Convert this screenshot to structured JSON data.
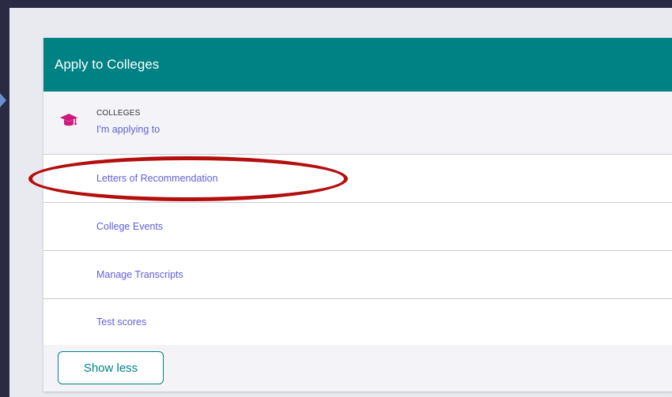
{
  "card": {
    "title": "Apply to Colleges",
    "colleges": {
      "label": "COLLEGES",
      "link": "I'm applying to",
      "icon": "graduation-cap-icon"
    },
    "links": [
      "Letters of Recommendation",
      "College Events",
      "Manage Transcripts",
      "Test scores"
    ],
    "show_less": "Show less"
  },
  "colors": {
    "header": "#008184",
    "link": "#5f5fd9",
    "icon": "#d1177c",
    "highlight": "#b40f0f"
  }
}
